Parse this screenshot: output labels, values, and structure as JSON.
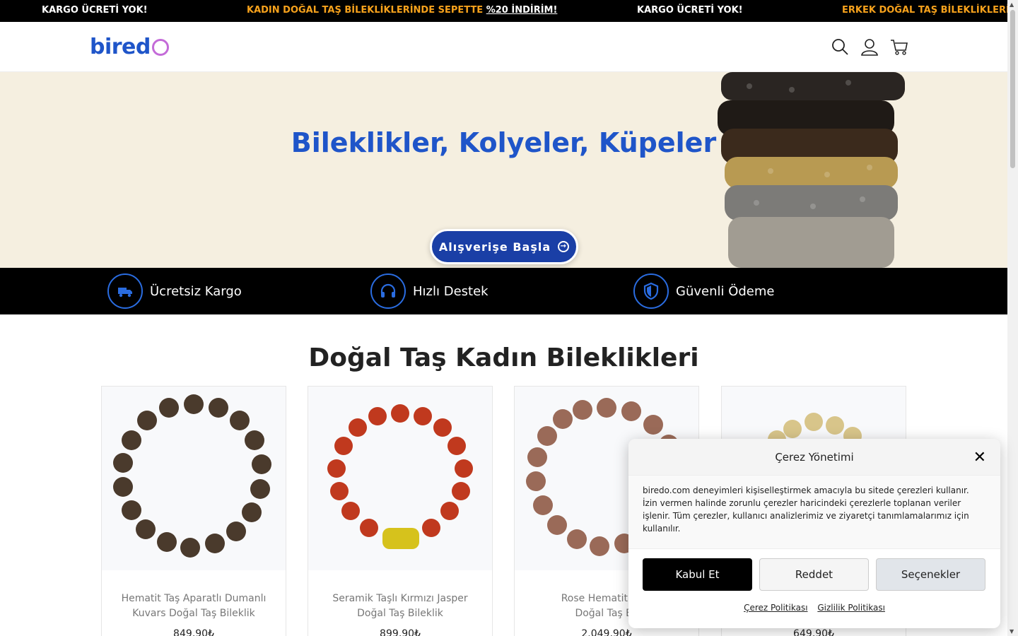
{
  "announcements": {
    "item1": "KARGO ÜCRETİ YOK!",
    "item2_prefix": "KADIN DOĞAL TAŞ BİLEKLİKLERİNDE SEPETTE ",
    "item2_highlight": "%20 İNDİRİM!",
    "item3": "KARGO ÜCRETİ YOK!",
    "item4": "ERKEK DOĞAL TAŞ BİLEKLİKLERİND"
  },
  "header": {
    "logo_text": "bired",
    "icons": [
      "search-icon",
      "user-icon",
      "cart-icon"
    ]
  },
  "hero": {
    "title": "Bileklikler, Kolyeler, Küpeler",
    "cta_label": "Alışverişe Başla"
  },
  "features": [
    {
      "label": "Ücretsiz Kargo",
      "icon": "truck-icon"
    },
    {
      "label": "Hızlı Destek",
      "icon": "headphones-icon"
    },
    {
      "label": "Güvenli Ödeme",
      "icon": "shield-icon"
    }
  ],
  "section": {
    "title": "Doğal Taş Kadın Bileklikleri"
  },
  "products": [
    {
      "name": "Hematit Taş Aparatlı Dumanlı Kuvars Doğal Taş Bileklik",
      "price": "849,90₺"
    },
    {
      "name": "Seramik Taşlı Kırmızı Jasper Doğal Taş Bileklik",
      "price": "899,90₺"
    },
    {
      "name_line1": "Rose Hematit Taşlı",
      "name_line2": "Doğal Taş Bil",
      "price": "2.049,90₺"
    },
    {
      "price": "649,90₺"
    }
  ],
  "cookie": {
    "title": "Çerez Yönetimi",
    "text": "biredo.com deneyimleri kişiselleştirmek amacıyla bu sitede çerezleri kullanır. İzin vermen halinde zorunlu çerezler haricindeki çerezlerle toplanan veriler işlenir. Tüm çerezler, kullanıcı analizlerimiz ve ziyaretçi tanımlamalarımız için kullanılır.",
    "accept_label": "Kabul Et",
    "deny_label": "Reddet",
    "options_label": "Seçenekler",
    "policy_link": "Çerez Politikası",
    "privacy_link": "Gizlilik Politikası"
  },
  "colors": {
    "brand_blue": "#1f55c9",
    "accent_orange": "#f7a21c",
    "logo_ring": "#c46bd8"
  }
}
